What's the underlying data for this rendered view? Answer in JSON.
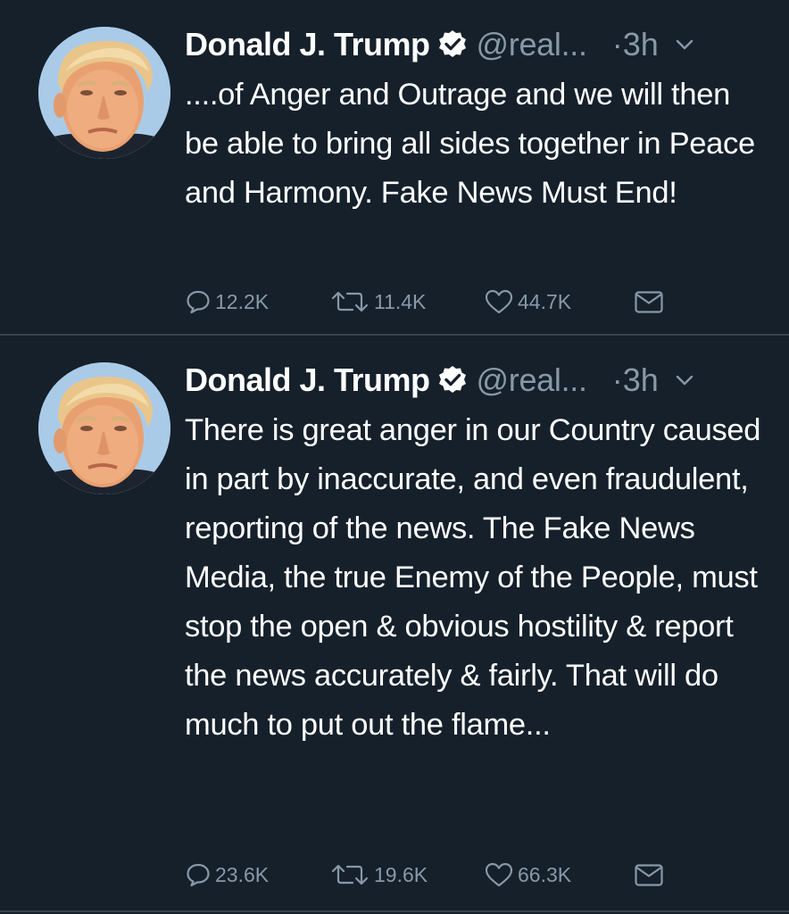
{
  "colors": {
    "background": "#15202b",
    "divider": "#38444d",
    "secondary_text": "#8899a6",
    "primary_text": "#ffffff",
    "verified_badge": "#ffffff"
  },
  "tweets": [
    {
      "author": "Donald J. Trump",
      "verified_icon": "verified-badge-icon",
      "handle": "@real...",
      "time": "·3h",
      "text": "....of Anger and Outrage and we will then be able to bring all sides together in Peace and Harmony. Fake News Must End!",
      "replies": "12.2K",
      "retweets": "11.4K",
      "likes": "44.7K"
    },
    {
      "author": "Donald J. Trump",
      "verified_icon": "verified-badge-icon",
      "handle": "@real...",
      "time": "·3h",
      "text": "There is great anger in our Country caused in part by inaccurate, and even fraudulent, reporting of the news. The Fake News Media, the true Enemy of the People, must stop the open & obvious hostility & report the news accurately & fairly. That will do much to put out the flame...",
      "replies": "23.6K",
      "retweets": "19.6K",
      "likes": "66.3K"
    }
  ]
}
